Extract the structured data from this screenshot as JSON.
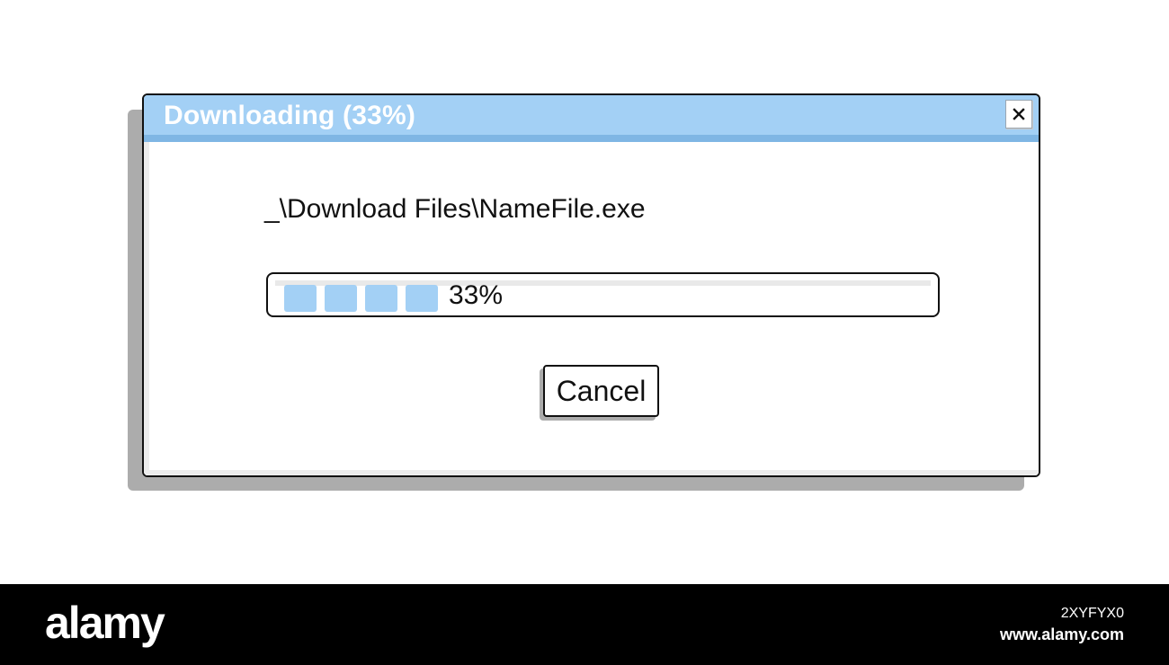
{
  "dialog": {
    "title": "Downloading (33%)",
    "close_icon": "close-icon",
    "file_path": "_\\Download Files\\NameFile.exe",
    "progress": {
      "percent": 33,
      "label": "33%",
      "blocks_filled": 4
    },
    "cancel_label": "Cancel"
  },
  "watermark": {
    "brand": "alamy",
    "image_id": "2XYFYX0",
    "url": "www.alamy.com"
  },
  "colors": {
    "title_bar": "#a3d0f5",
    "title_bar_edge": "#7fb6e4",
    "progress_fill": "#a3d0f5",
    "shadow": "#acacac",
    "border": "#111111"
  }
}
